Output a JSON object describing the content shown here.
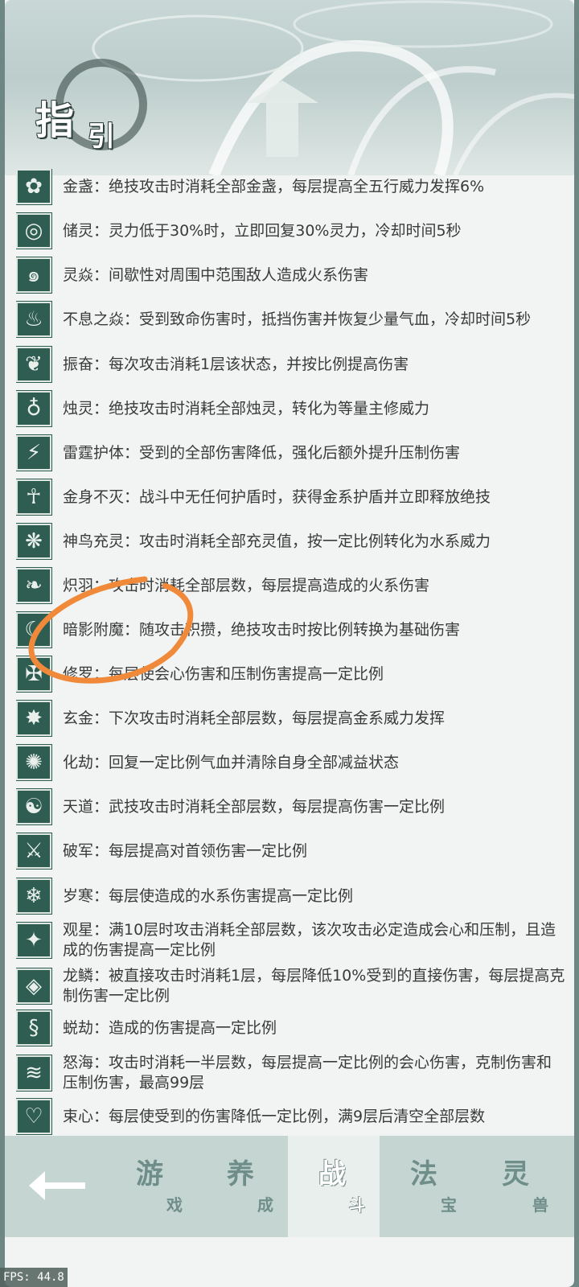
{
  "header": {
    "title_main": "指",
    "title_sub": "引"
  },
  "entries": [
    {
      "icon": "flower-icon",
      "glyph": "✿",
      "text": "金盏：绝技攻击时消耗全部金盏，每层提高全五行威力发挥6%"
    },
    {
      "icon": "ring-icon",
      "glyph": "◎",
      "text": "储灵：灵力低于30%时，立即回复30%灵力，冷却时间5秒"
    },
    {
      "icon": "swirl-icon",
      "glyph": "๑",
      "text": "灵焱：间歇性对周围中范围敌人造成火系伤害"
    },
    {
      "icon": "phoenix-icon",
      "glyph": "♨",
      "text": "不息之焱：受到致命伤害时，抵挡伤害并恢复少量气血，冷却时间5秒"
    },
    {
      "icon": "rooster-icon",
      "glyph": "❦",
      "text": "振奋：每次攻击消耗1层该状态，并按比例提高伤害"
    },
    {
      "icon": "candle-icon",
      "glyph": "♁",
      "text": "烛灵：绝技攻击时消耗全部烛灵，转化为等量主修威力"
    },
    {
      "icon": "thunder-body-icon",
      "glyph": "⚡",
      "text": "雷霆护体：受到的全部伤害降低，强化后额外提升压制伤害"
    },
    {
      "icon": "golden-body-icon",
      "glyph": "☥",
      "text": "金身不灭：战斗中无任何护盾时，获得金系护盾并立即释放绝技"
    },
    {
      "icon": "divine-bird-icon",
      "glyph": "❋",
      "text": "神鸟充灵：攻击时消耗全部充灵值，按一定比例转化为水系威力"
    },
    {
      "icon": "feather-icon",
      "glyph": "❧",
      "text": "炽羽：攻击时消耗全部层数，每层提高造成的火系伤害"
    },
    {
      "icon": "shadow-icon",
      "glyph": "☾",
      "text": "暗影附魔：随攻击积攒，绝技攻击时按比例转换为基础伤害"
    },
    {
      "icon": "asura-icon",
      "glyph": "✠",
      "text": "修罗：每层使会心伤害和压制伤害提高一定比例"
    },
    {
      "icon": "gold-crystal-icon",
      "glyph": "✸",
      "text": "玄金：下次攻击时消耗全部层数，每层提高金系威力发挥"
    },
    {
      "icon": "tribulation-icon",
      "glyph": "✺",
      "text": "化劫：回复一定比例气血并清除自身全部减益状态"
    },
    {
      "icon": "yin-yang-icon",
      "glyph": "☯",
      "text": "天道：武技攻击时消耗全部层数，每层提高伤害一定比例"
    },
    {
      "icon": "sword-icon",
      "glyph": "⚔",
      "text": "破军：每层提高对首领伤害一定比例"
    },
    {
      "icon": "snowflake-icon",
      "glyph": "❄",
      "text": "岁寒：每层使造成的水系伤害提高一定比例"
    },
    {
      "icon": "constellation-icon",
      "glyph": "✦",
      "text": "观星：满10层时攻击消耗全部层数，该次攻击必定造成会心和压制，且造成的伤害提高一定比例"
    },
    {
      "icon": "dragon-scale-icon",
      "glyph": "◈",
      "text": "龙鳞：被直接攻击时消耗1层，每层降低10%受到的直接伤害，每层提高克制伤害一定比例"
    },
    {
      "icon": "dragon-icon",
      "glyph": "§",
      "text": "蜕劫：造成的伤害提高一定比例"
    },
    {
      "icon": "wave-icon",
      "glyph": "≋",
      "text": "怒海：攻击时消耗一半层数，每层提高一定比例的会心伤害，克制伤害和压制伤害，最高99层"
    },
    {
      "icon": "heart-bind-icon",
      "glyph": "♡",
      "text": "束心：每层使受到的伤害降低一定比例，满9层后清空全部层数"
    }
  ],
  "nav": {
    "back_icon": "back-arrow-icon",
    "tabs": [
      {
        "id": "game",
        "big": "游",
        "small": "戏",
        "active": false
      },
      {
        "id": "cultivate",
        "big": "养",
        "small": "成",
        "active": false
      },
      {
        "id": "battle",
        "big": "战",
        "small": "斗",
        "active": true
      },
      {
        "id": "treasure",
        "big": "法",
        "small": "宝",
        "active": false
      },
      {
        "id": "beast",
        "big": "灵",
        "small": "兽",
        "active": false
      }
    ]
  },
  "fps": "FPS: 44.8",
  "colors": {
    "icon_bg": "#2f5d52",
    "annotation": "#f08a3a",
    "active_tab": "#e9efed"
  }
}
